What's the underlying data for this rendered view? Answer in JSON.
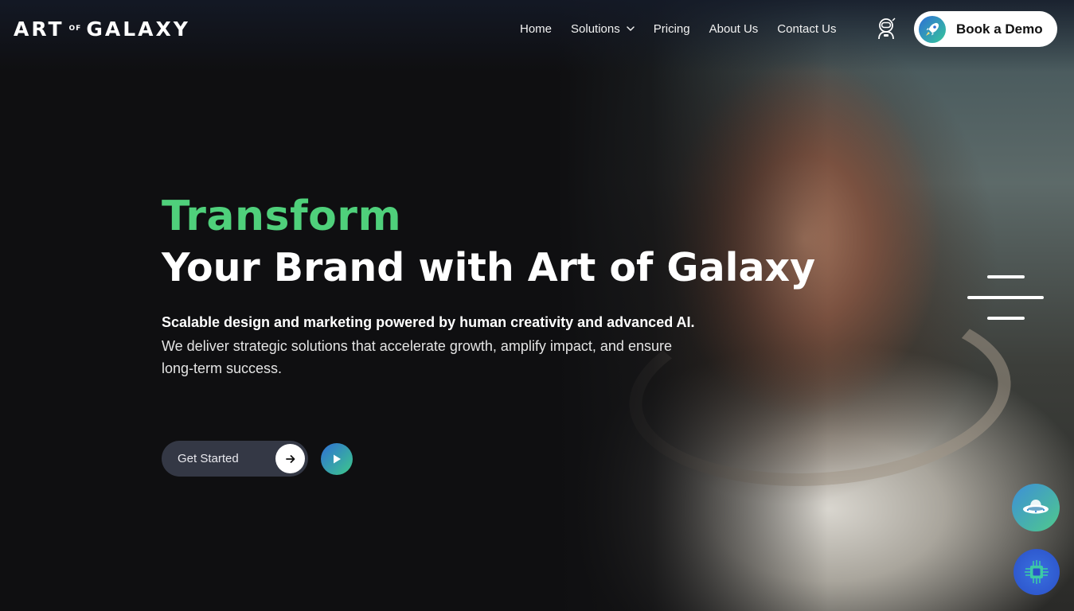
{
  "brand": {
    "logo_part1": "ART",
    "logo_of": "OF",
    "logo_part2": "GALAXY"
  },
  "nav": {
    "items": [
      {
        "label": "Home"
      },
      {
        "label": "Solutions",
        "has_dropdown": true
      },
      {
        "label": "Pricing"
      },
      {
        "label": "About Us"
      },
      {
        "label": "Contact Us"
      }
    ],
    "account_icon": "astronaut-icon",
    "demo_label": "Book a Demo",
    "demo_icon": "rocket-icon"
  },
  "hero": {
    "title_highlight": "Transform",
    "title_rest": "Your Brand with Art of Galaxy",
    "lead": "Scalable design and marketing powered by human creativity and advanced AI.",
    "description": "We deliver strategic solutions that accelerate growth, amplify impact, and ensure long-term success.",
    "cta_label": "Get Started",
    "cta_icon": "arrow-right-icon",
    "play_icon": "play-icon"
  },
  "widgets": {
    "menu_icon": "hamburger-menu-icon",
    "ufo_icon": "ufo-icon",
    "chip_icon": "ai-chip-icon"
  },
  "colors": {
    "accent_green": "#4fd07b",
    "background": "#0f0f11",
    "cta_bg": "#343845",
    "gradient_blue": "#2f6fd6",
    "gradient_green": "#3dc98a"
  }
}
